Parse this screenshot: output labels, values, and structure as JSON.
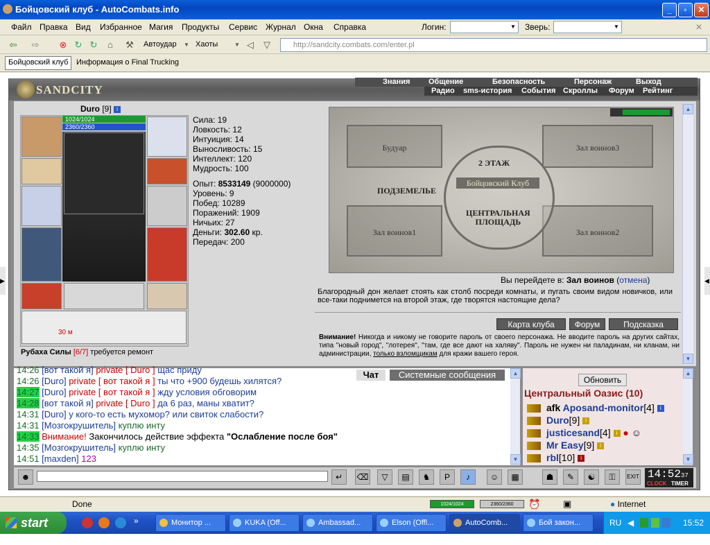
{
  "window": {
    "title": "Бойцовский клуб - AutoCombats.info"
  },
  "menu": {
    "items": [
      "Файл",
      "Правка",
      "Вид",
      "Избранное",
      "Магия",
      "Продукты",
      "Сервис",
      "Журнал",
      "Окна",
      "Справка"
    ],
    "login_label": "Логин:",
    "beast_label": "Зверь:"
  },
  "toolbar": {
    "autoudar": "Автоудар",
    "haoty": "Хаоты",
    "address": "http://sandcity.combats.com/enter.pl"
  },
  "links": {
    "tab_active": "Бойцовский клуб",
    "tab_other": "Информация о Final Trucking"
  },
  "game": {
    "logo": "SANDCITY",
    "nav_top": [
      "Знания",
      "Общение",
      "Безопасность",
      "Персонаж",
      "Выход"
    ],
    "nav_bottom": [
      "Радио",
      "sms-история",
      "События",
      "Скроллы",
      "Форум",
      "Рейтинг"
    ]
  },
  "character": {
    "name": "Duro",
    "level": "[9]",
    "hp": "1024/1024",
    "mana": "2360/2360",
    "item_note_name": "Рубаха Силы",
    "item_note_count": "[6/7]",
    "item_note_text": "требуется ремонт",
    "timer_label": "30 м"
  },
  "stats": {
    "lines": [
      "Сила: 19",
      "Ловкость: 12",
      "Интуиция: 14",
      "Выносливость: 15",
      "Интеллект: 120",
      "Мудрость: 100"
    ],
    "exp_label": "Опыт: ",
    "exp_value": "8533149",
    "exp_next": " (9000000)",
    "lines2": [
      "Уровень: 9",
      "Побед: 10289",
      "Поражений: 1909",
      "Ничьих: 27"
    ],
    "money_label": "Деньги: ",
    "money_value": "302.60",
    "money_unit": " кр.",
    "transfers": "Передач: 200"
  },
  "map": {
    "rooms": {
      "boudoir": "Будуар",
      "warriors3": "Зал воинов3",
      "floor2": "2 ЭТАЖ",
      "club": "Бойцовский Клуб",
      "underground": "ПОДЗЕМЕЛЬЕ",
      "central1": "ЦЕНТРАЛЬНАЯ",
      "central2": "ПЛОЩАДЬ",
      "warriors1": "Зал воинов1",
      "warriors2": "Зал воинов2"
    },
    "go_prefix": "Вы перейдете в: ",
    "go_target": "Зал воинов",
    "go_cancel": "отмена",
    "description": "Благородный дон желает стоять как столб посреди комнаты, и пугать своим видом новичков, или все-таки поднимется на второй этаж, где творятся настоящие дела?",
    "buttons": [
      "Карта клуба",
      "Форум",
      "Подсказка"
    ],
    "warning_bold": "Внимание!",
    "warning_text": " Никогда и никому не говорите пароль от своего персонажа. Не вводите пароль на других сайтах, типа \"новый город\", \"лотерея\", \"там, где все дают на халяву\". Пароль не нужен ни паладинам, ни кланам, ни администрации, ",
    "warning_underline": "только взломщикам",
    "warning_end": " для кражи вашего героя."
  },
  "chat": {
    "tab_chat": "Чат",
    "tab_system": "Системные сообщения",
    "lines": [
      {
        "time": "14:26",
        "nick": "[вот такой я]",
        "priv": "private [ Duro ]",
        "text": "щас приду"
      },
      {
        "time": "14:26",
        "nick": "[Duro]",
        "priv": "private [ вот такой я ]",
        "text": "ты что +900 будешь хилятся?"
      },
      {
        "time": "14:27",
        "nick": "[Duro]",
        "priv": "private [ вот такой я ]",
        "text": "жду условия обговорим"
      },
      {
        "time": "14:28",
        "nick": "[вот такой я]",
        "priv": "private [ Duro ]",
        "text": "да 6 раз, маны хватит?"
      },
      {
        "time": "14:31",
        "nick": "[Duro]",
        "priv": "",
        "text": "у кого-то есть мухомор? или свиток слабости?"
      },
      {
        "time": "14:31",
        "nick": "[Мозгокрушитель]",
        "priv": "",
        "text": "куплю инту"
      },
      {
        "time": "14:33",
        "nick": "",
        "priv": "Внимание!",
        "text": "Закончилось действие эффекта ",
        "effect": "\"Ослабление после боя\""
      },
      {
        "time": "14:35",
        "nick": "[Мозгокрушитель]",
        "priv": "",
        "text": "куплю инту"
      },
      {
        "time": "14:51",
        "nick": "[maxden]",
        "priv": "",
        "text": "123"
      }
    ]
  },
  "online": {
    "refresh": "Обновить",
    "location": "Центральный Оазис (10)",
    "users": [
      {
        "prefix": "afk ",
        "name": "Aposand-monitor",
        "level": "[4]"
      },
      {
        "prefix": "",
        "name": "Duro",
        "level": "[9]"
      },
      {
        "prefix": "",
        "name": "justicesand",
        "level": "[4]"
      },
      {
        "prefix": "",
        "name": "Mr Easy",
        "level": "[9]"
      },
      {
        "prefix": "",
        "name": "rbl",
        "level": "[10]"
      }
    ]
  },
  "clock": {
    "time": "14:52",
    "sec": "37",
    "clock_lbl": "CLOCK",
    "timer_lbl": "TIMER",
    "exit": "EXIT"
  },
  "status": {
    "done": "Done",
    "hp": "1024/1024",
    "mp": "2360/2360",
    "zone": "Internet"
  },
  "taskbar": {
    "start": "start",
    "tasks": [
      "Монитор ...",
      "KUKA (Off...",
      "Ambassad...",
      "Elson (Offl...",
      "AutoComb...",
      "Бой закон..."
    ],
    "lang": "RU",
    "time": "15:52"
  }
}
